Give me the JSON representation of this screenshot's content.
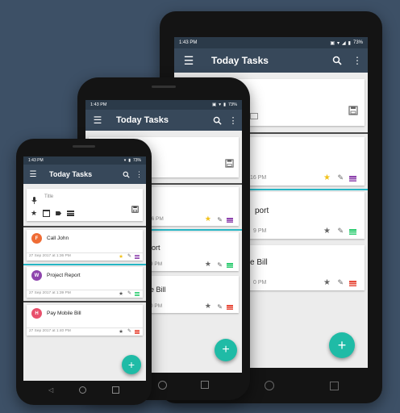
{
  "status": {
    "time": "1:43 PM",
    "battery": "73%"
  },
  "app": {
    "title": "Today Tasks",
    "title_placeholder": "Title",
    "fab_label": "+"
  },
  "tasks": [
    {
      "initial": "F",
      "name": "Call John",
      "date": "27 Sep 2017 at 1:36 PM",
      "color": "#ef6c35"
    },
    {
      "initial": "W",
      "name": "Project Report",
      "date": "27 Sep 2017 at 1:39 PM",
      "color": "#8e44ad"
    },
    {
      "initial": "H",
      "name": "Pay Mobile Bill",
      "date": "27 Sep 2017 at 1:40 PM",
      "color": "#e8506c"
    }
  ],
  "tablet": {
    "peek_times": [
      "16 PM",
      "9 PM",
      "0 PM"
    ],
    "peek_names": [
      "port",
      "e Bill"
    ]
  },
  "mid_phone": {
    "peek_times": [
      "36 PM",
      "9 PM",
      "0 PM"
    ],
    "peek_names": [
      "ort",
      "e Bill"
    ]
  },
  "colors": {
    "toolbar": "#37485a",
    "status": "#2b3a49",
    "accent": "#1fbba6",
    "star": "#f2c21b",
    "divider_teal": "#26b5c4"
  }
}
